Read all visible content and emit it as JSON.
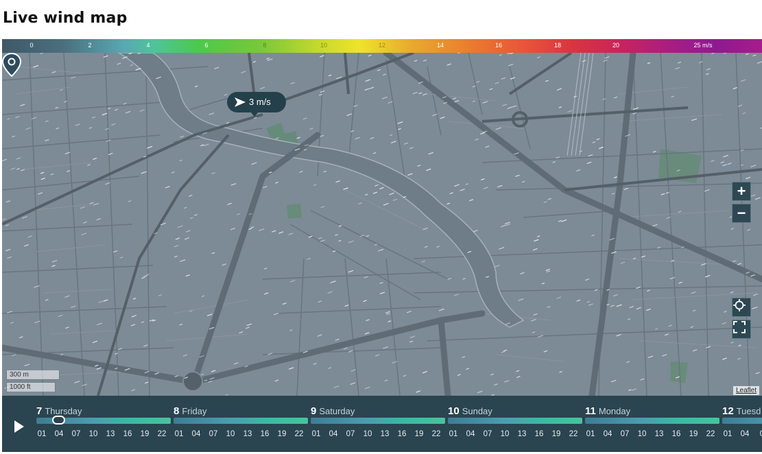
{
  "page": {
    "title": "Live wind map"
  },
  "scale": {
    "labels": [
      "0",
      "2",
      "4",
      "6",
      "8",
      "10",
      "12",
      "14",
      "16",
      "18",
      "20",
      "25 m/s"
    ],
    "colors": [
      "#3f5868",
      "#58a8b2",
      "#4cc94a",
      "#efe32a",
      "#ea7a2e",
      "#d9353f",
      "#a81d82"
    ]
  },
  "tooltip": {
    "speed": "3 m/s"
  },
  "map_scale": {
    "metric": "300 m",
    "imperial": "1000 ft"
  },
  "attribution": {
    "text": "Leaflet"
  },
  "controls": {
    "zoom_in": "+",
    "zoom_out": "−"
  },
  "icons": [
    "wind-direction-arrow-icon",
    "location-pin-icon",
    "locate-icon",
    "fullscreen-icon",
    "play-icon"
  ],
  "timeline": {
    "days": [
      {
        "num": "7",
        "name": "Thursday"
      },
      {
        "num": "8",
        "name": "Friday"
      },
      {
        "num": "9",
        "name": "Saturday"
      },
      {
        "num": "10",
        "name": "Sunday"
      },
      {
        "num": "11",
        "name": "Monday"
      },
      {
        "num": "12",
        "name": "Tuesd"
      }
    ],
    "hours": [
      "01",
      "04",
      "07",
      "10",
      "13",
      "16",
      "19",
      "22"
    ],
    "last_partial_hours": [
      "01",
      "04",
      "0"
    ],
    "selected": "Thursday 04"
  }
}
